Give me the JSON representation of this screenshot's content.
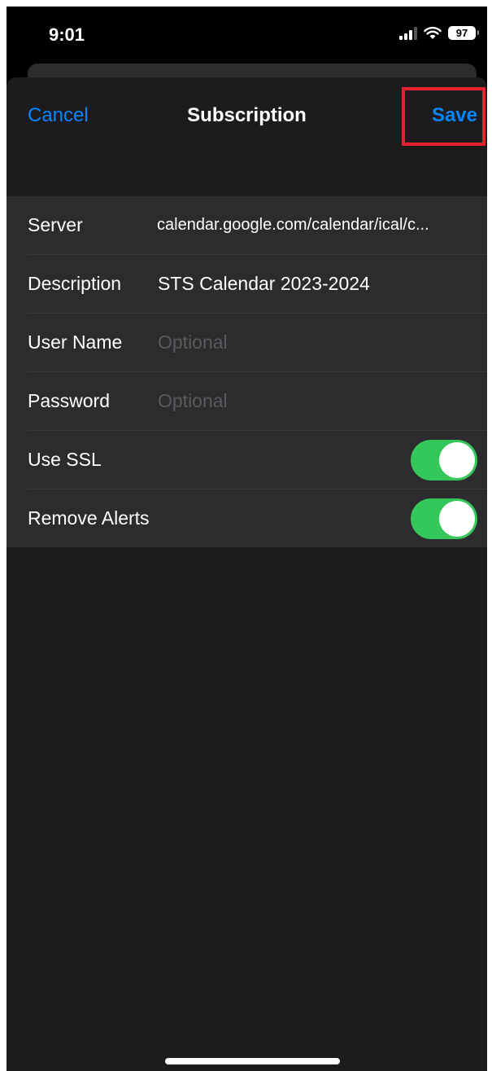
{
  "status_bar": {
    "time": "9:01",
    "battery": "97",
    "icons": [
      "signal-icon",
      "wifi-icon",
      "battery-icon"
    ]
  },
  "nav": {
    "cancel_label": "Cancel",
    "title": "Subscription",
    "save_label": "Save"
  },
  "form": {
    "server": {
      "label": "Server",
      "value": "calendar.google.com/calendar/ical/c..."
    },
    "description": {
      "label": "Description",
      "value": "STS Calendar 2023-2024"
    },
    "user_name": {
      "label": "User Name",
      "placeholder": "Optional"
    },
    "password": {
      "label": "Password",
      "placeholder": "Optional"
    },
    "use_ssl": {
      "label": "Use SSL",
      "on": true
    },
    "remove_alerts": {
      "label": "Remove Alerts",
      "on": true
    }
  },
  "colors": {
    "accent": "#0a84ff",
    "toggle_on": "#34c759",
    "highlight": "#e8212e",
    "sheet_bg": "#1c1c1e",
    "group_bg": "#2c2c2e"
  }
}
